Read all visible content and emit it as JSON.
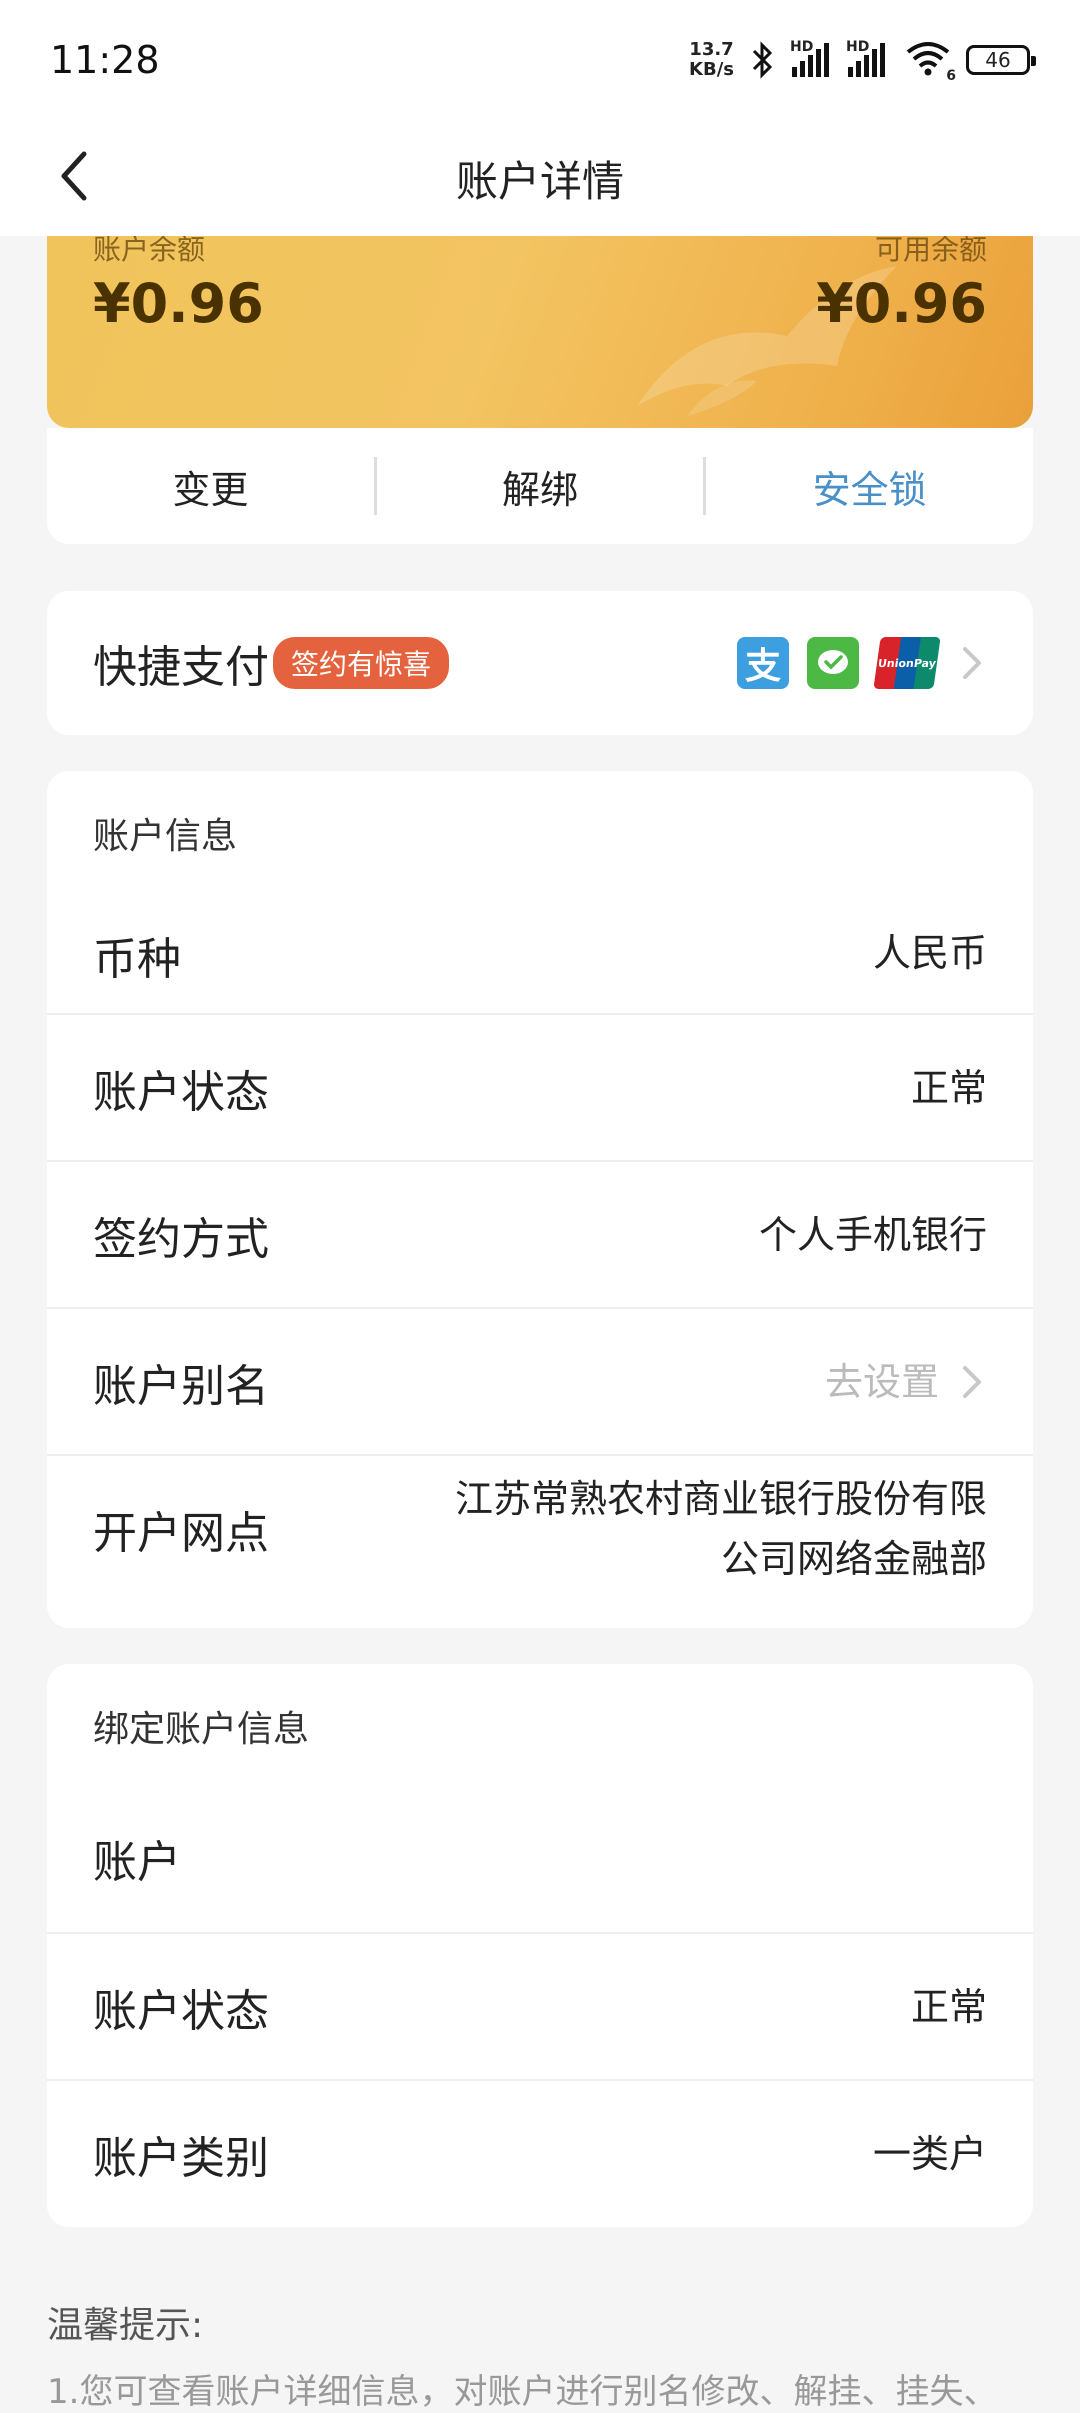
{
  "status": {
    "time": "11:28",
    "net_speed_value": "13.7",
    "net_speed_unit": "KB/s",
    "signal_label_1": "HD",
    "signal_label_2": "HD",
    "wifi_badge": "6",
    "battery": "46"
  },
  "nav": {
    "title": "账户详情"
  },
  "card": {
    "balance_label": "账户余额",
    "balance_value": "¥0.96",
    "available_label": "可用余额",
    "available_value": "¥0.96",
    "actions": [
      "变更",
      "解绑",
      "安全锁"
    ]
  },
  "quick_pay": {
    "title": "快捷支付",
    "badge": "签约有惊喜",
    "icons": [
      "alipay-icon",
      "wechat-pay-icon",
      "unionpay-icon"
    ],
    "alipay_glyph": "支",
    "unionpay_text": "UnionPay"
  },
  "account_info": {
    "heading": "账户信息",
    "rows": [
      {
        "key": "币种",
        "value": "人民币"
      },
      {
        "key": "账户状态",
        "value": "正常"
      },
      {
        "key": "签约方式",
        "value": "个人手机银行"
      },
      {
        "key": "账户别名",
        "value": "去设置"
      },
      {
        "key": "开户网点",
        "value_line1": "江苏常熟农村商业银行股份有限",
        "value_line2": "公司网络金融部"
      }
    ]
  },
  "bound_info": {
    "heading": "绑定账户信息",
    "rows": [
      {
        "key": "账户",
        "value": ""
      },
      {
        "key": "账户状态",
        "value": "正常"
      },
      {
        "key": "账户类别",
        "value": "一类户"
      }
    ]
  },
  "tips": {
    "title": "温馨提示:",
    "line1": "1.您可查看账户详细信息，对账户进行别名修改、解挂、挂失、"
  },
  "colors": {
    "card_gold": "#f0c45a",
    "badge_red": "#e4623d",
    "link_blue": "#4a90c8",
    "alipay_blue": "#3d9ee0",
    "wechat_green": "#4cb944",
    "unionpay_red": "#d8232a"
  }
}
